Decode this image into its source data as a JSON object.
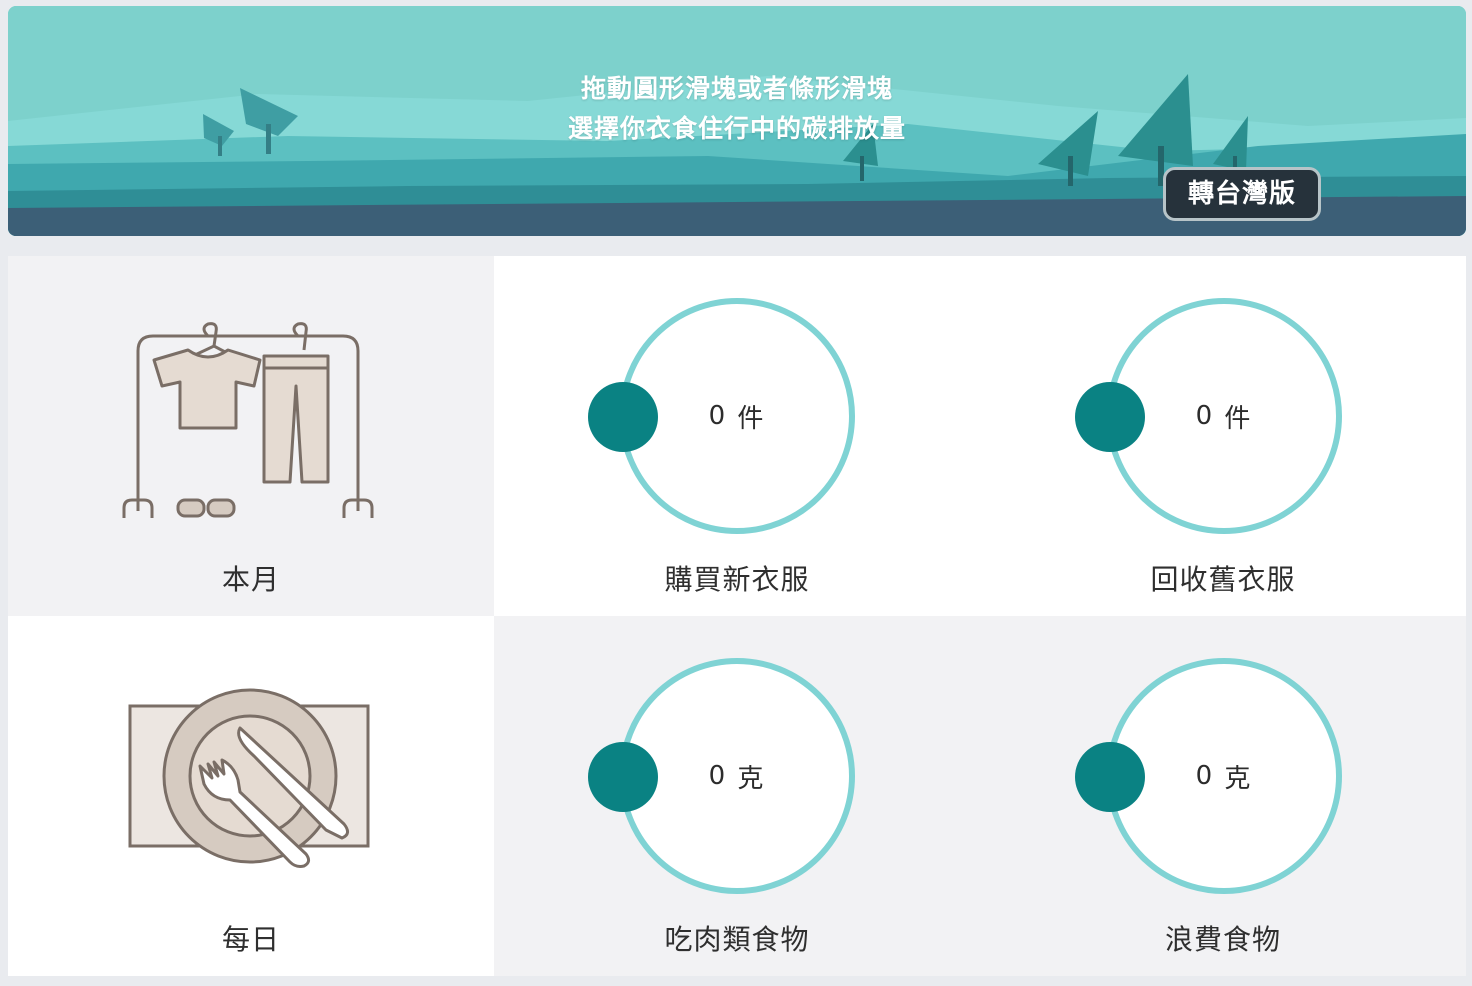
{
  "banner": {
    "line1": "拖動圓形滑塊或者條形滑塊",
    "line2": "選擇你衣食住行中的碳排放量",
    "lang_button": "轉台灣版"
  },
  "colors": {
    "accent": "#0a8283",
    "ring": "#7fd3d4",
    "banner_sky": "#7dd1cc",
    "button_bg": "#26323b"
  },
  "rows": [
    {
      "period": "本月",
      "icon": "clothes-rack-icon",
      "items": [
        {
          "label": "購買新衣服",
          "value": "0",
          "unit": "件"
        },
        {
          "label": "回收舊衣服",
          "value": "0",
          "unit": "件"
        }
      ]
    },
    {
      "period": "每日",
      "icon": "plate-cutlery-icon",
      "items": [
        {
          "label": "吃肉類食物",
          "value": "0",
          "unit": "克"
        },
        {
          "label": "浪費食物",
          "value": "0",
          "unit": "克"
        }
      ]
    }
  ]
}
